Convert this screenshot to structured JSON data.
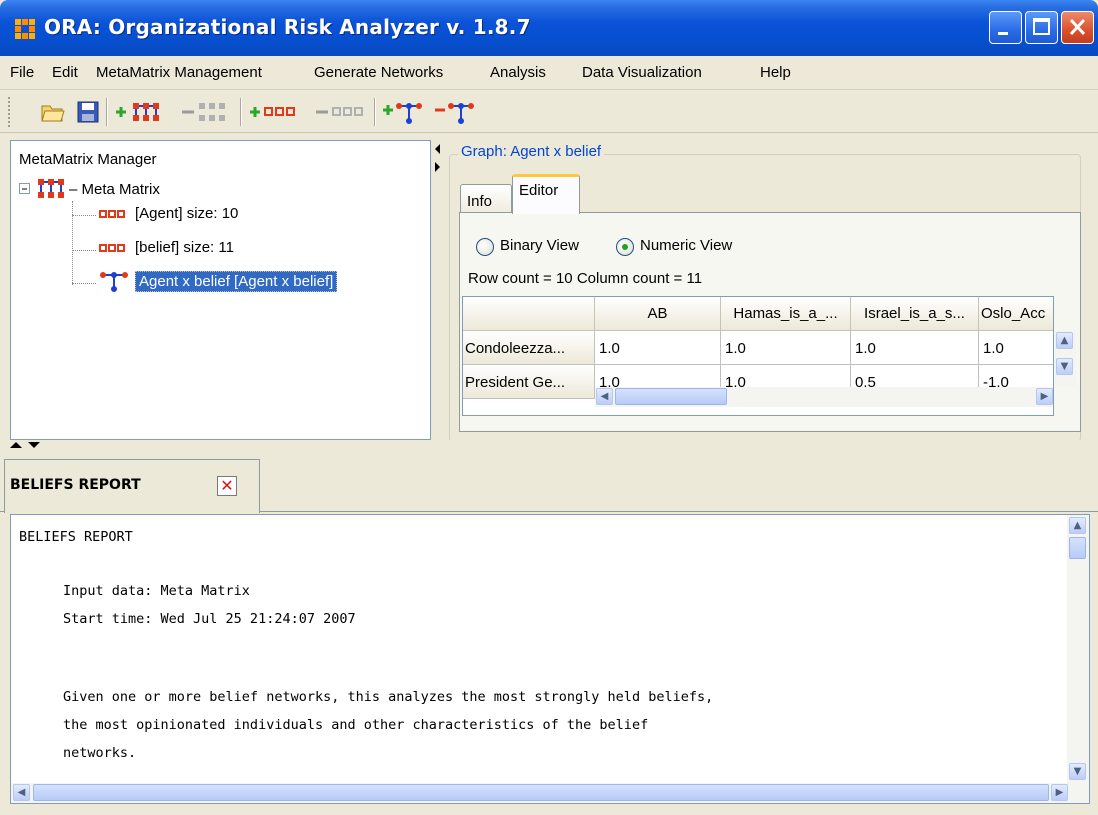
{
  "window": {
    "title": "ORA: Organizational Risk Analyzer v. 1.8.7"
  },
  "menu": [
    "File",
    "Edit",
    "MetaMatrix Management",
    "Generate Networks",
    "Analysis",
    "Data Visualization",
    "Help"
  ],
  "tree": {
    "title": "MetaMatrix Manager",
    "root": "Meta Matrix",
    "items": [
      "[Agent] size: 10",
      "[belief] size: 11",
      "Agent x belief [Agent x belief]"
    ]
  },
  "graph": {
    "title": "Graph: Agent x belief",
    "tabs": [
      "Info",
      "Editor"
    ],
    "active_tab": "Editor",
    "views": [
      "Binary View",
      "Numeric View"
    ],
    "selected_view": "Numeric View",
    "counts": "Row count = 10 Column count = 11",
    "columns": [
      "",
      "AB",
      "Hamas_is_a_...",
      "Israel_is_a_s...",
      "Oslo_Acc"
    ],
    "rows": [
      [
        "Condoleezza...",
        "1.0",
        "1.0",
        "1.0",
        "1.0"
      ],
      [
        "President Ge...",
        "1.0",
        "1.0",
        "0.5",
        "-1.0"
      ]
    ]
  },
  "report": {
    "tab_label": "BELIEFS REPORT",
    "lines": [
      "BELIEFS REPORT",
      "Input data: Meta Matrix",
      "Start time: Wed Jul 25 21:24:07 2007",
      "Given one or more belief networks, this analyzes the most strongly held beliefs,",
      "the most opinionated individuals and other characteristics of the belief",
      "networks."
    ]
  },
  "colors": {
    "titlebar": "#0a52d8",
    "selection": "#316ac5",
    "tab_highlight": "#ffc83c"
  },
  "icons": [
    "app-icon",
    "open-folder-icon",
    "save-icon",
    "add-metamatrix-icon",
    "remove-metamatrix-icon",
    "add-nodeset-icon",
    "remove-nodeset-icon",
    "add-graph-icon",
    "remove-graph-icon",
    "close-icon"
  ]
}
